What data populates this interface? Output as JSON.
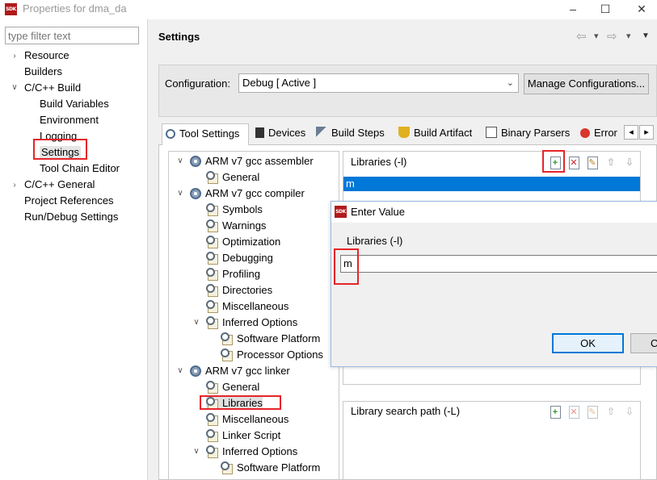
{
  "window": {
    "title": "Properties for dma_da",
    "minimize": "–",
    "maximize": "☐",
    "close": "✕"
  },
  "filter": {
    "placeholder": "type filter text"
  },
  "sidebar": {
    "items": [
      {
        "label": "Resource"
      },
      {
        "label": "Builders"
      },
      {
        "label": "C/C++ Build"
      },
      {
        "label": "Build Variables"
      },
      {
        "label": "Environment"
      },
      {
        "label": "Logging"
      },
      {
        "label": "Settings"
      },
      {
        "label": "Tool Chain Editor"
      },
      {
        "label": "C/C++ General"
      },
      {
        "label": "Project References"
      },
      {
        "label": "Run/Debug Settings"
      }
    ]
  },
  "header": {
    "title": "Settings",
    "back": "⇦",
    "forward": "⇨",
    "dropdown": "▾",
    "menu": "▼"
  },
  "config": {
    "label": "Configuration:",
    "value": "Debug  [ Active ]",
    "arrow": "⌄",
    "manage_button": "Manage Configurations..."
  },
  "tabs": [
    {
      "label": "Tool Settings"
    },
    {
      "label": "Devices"
    },
    {
      "label": "Build Steps"
    },
    {
      "label": "Build Artifact"
    },
    {
      "label": "Binary Parsers"
    },
    {
      "label": "Error"
    }
  ],
  "tab_scroll": {
    "left": "◂",
    "right": "▸"
  },
  "tree": {
    "nodes": [
      {
        "label": "ARM v7 gcc assembler"
      },
      {
        "label": "General"
      },
      {
        "label": "ARM v7 gcc compiler"
      },
      {
        "label": "Symbols"
      },
      {
        "label": "Warnings"
      },
      {
        "label": "Optimization"
      },
      {
        "label": "Debugging"
      },
      {
        "label": "Profiling"
      },
      {
        "label": "Directories"
      },
      {
        "label": "Miscellaneous"
      },
      {
        "label": "Inferred Options"
      },
      {
        "label": "Software Platform"
      },
      {
        "label": "Processor Options"
      },
      {
        "label": "ARM v7 gcc linker"
      },
      {
        "label": "General"
      },
      {
        "label": "Libraries"
      },
      {
        "label": "Miscellaneous"
      },
      {
        "label": "Linker Script"
      },
      {
        "label": "Inferred Options"
      },
      {
        "label": "Software Platform"
      }
    ]
  },
  "libraries": {
    "label": "Libraries (-l)",
    "items": [
      "m"
    ]
  },
  "library_search_path": {
    "label": "Library search path (-L)"
  },
  "dialog": {
    "title": "Enter Value",
    "label": "Libraries (-l)",
    "value": "m",
    "ok": "OK",
    "cancel": "Cancel"
  },
  "icons": {
    "app": "SDK",
    "expanded": "∨",
    "collapsed": "›"
  },
  "colors": {
    "highlight": "#e5252a",
    "selection": "#0078d7",
    "sdk_icon": "#b01a1a"
  }
}
